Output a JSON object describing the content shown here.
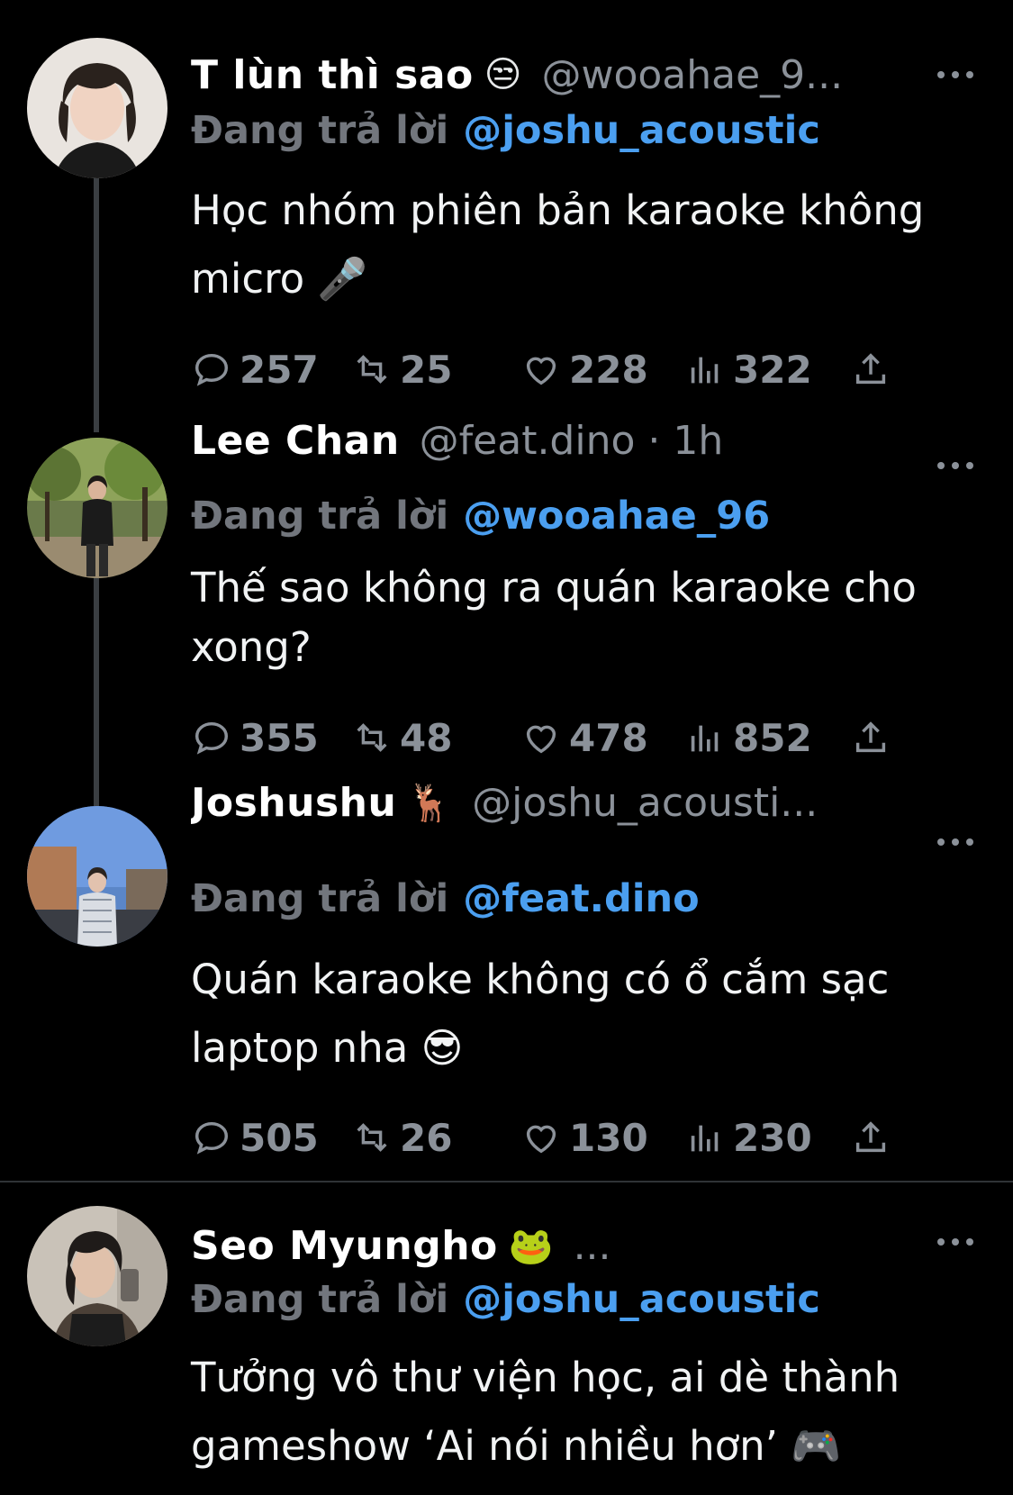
{
  "tweets": [
    {
      "name": "T lùn thì sao",
      "emoji": "😒",
      "handle": "@wooahae_9...",
      "reply_prefix": "Đang trả lời",
      "reply_to": "@joshu_acoustic",
      "text": "Học nhóm phiên bản karaoke không micro 🎤",
      "replies": "257",
      "retweets": "25",
      "likes": "228",
      "views": "322"
    },
    {
      "name": "Lee Chan",
      "emoji": "",
      "handle": "@feat.dino · 1h",
      "reply_prefix": "Đang trả lời",
      "reply_to": "@wooahae_96",
      "text": "Thế sao không ra quán karaoke cho xong?",
      "replies": "355",
      "retweets": "48",
      "likes": "478",
      "views": "852"
    },
    {
      "name": "Joshushu",
      "emoji": "🦌",
      "handle": "@joshu_acousti...",
      "reply_prefix": "Đang trả lời",
      "reply_to": "@feat.dino",
      "text": "Quán karaoke không có ổ cắm sạc laptop nha 😎",
      "replies": "505",
      "retweets": "26",
      "likes": "130",
      "views": "230"
    },
    {
      "name": "Seo Myungho",
      "emoji": "🐸",
      "handle": "...",
      "reply_prefix": "Đang trả lời",
      "reply_to": "@joshu_acoustic",
      "text": "Tưởng vô thư viện học, ai dè thành gameshow ‘Ai nói nhiều hơn’ 🎮"
    }
  ],
  "icons": {
    "reply": "comment-icon",
    "retweet": "retweet-icon",
    "like": "heart-icon",
    "views": "views-icon",
    "share": "share-icon",
    "more": "more-icon"
  },
  "colors": {
    "background": "#000000",
    "link": "#4b9ff0",
    "muted": "#8b9199"
  }
}
